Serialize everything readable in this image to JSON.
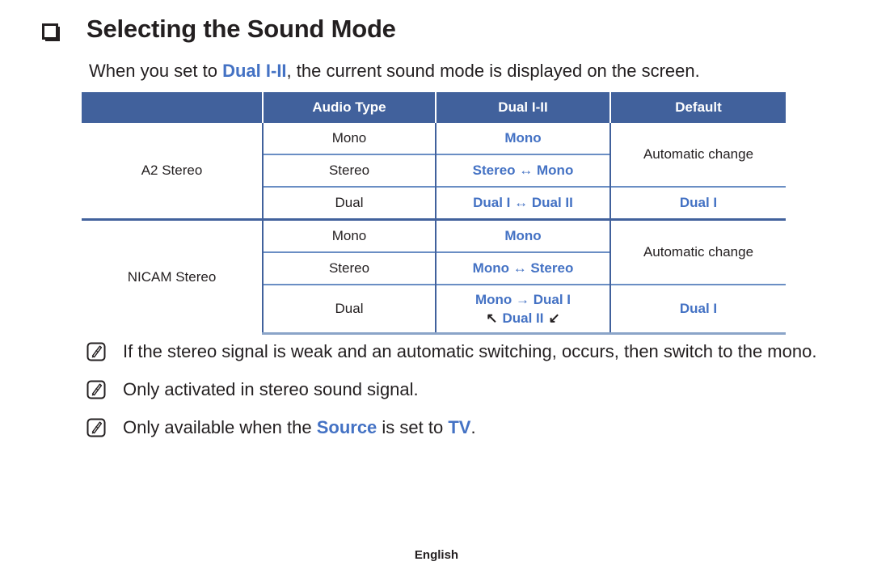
{
  "page": {
    "title": "Selecting the Sound Mode",
    "bullet_icon": "square-bullet-icon",
    "intro_before": "When you set to ",
    "intro_highlight": "Dual I-II",
    "intro_after": ", the current sound mode is displayed on the screen.",
    "footer": "English"
  },
  "colors": {
    "header_blue": "#41619c",
    "accent_blue": "#4472c4",
    "rule_blue": "#6a8ec4",
    "text_dark": "#231f20"
  },
  "table": {
    "headers": [
      "",
      "Audio Type",
      "Dual I-II",
      "Default"
    ],
    "groups": [
      {
        "name": "A2 Stereo",
        "rows": [
          {
            "audio_type": "Mono",
            "dual": "Mono",
            "default": "Automatic change"
          },
          {
            "audio_type": "Stereo",
            "dual": "Stereo ↔ Mono",
            "default": ""
          },
          {
            "audio_type": "Dual",
            "dual": "Dual I ↔ Dual II",
            "default": "Dual I"
          }
        ]
      },
      {
        "name": "NICAM Stereo",
        "rows": [
          {
            "audio_type": "Mono",
            "dual": "Mono",
            "default": "Automatic change"
          },
          {
            "audio_type": "Stereo",
            "dual": "Mono ↔ Stereo",
            "default": ""
          },
          {
            "audio_type": "Dual",
            "dual_line1": "Mono → Dual I",
            "dual_line2_arrow_left": "↖",
            "dual_line2_text": "Dual II",
            "dual_line2_arrow_right": "↙",
            "default": "Dual I"
          }
        ]
      }
    ]
  },
  "notes": [
    {
      "icon": "note-pencil-icon",
      "text_before": "If the stereo signal is weak and an automatic switching, occurs, then switch to the mono.",
      "highlight": "",
      "text_after": ""
    },
    {
      "icon": "note-pencil-icon",
      "text_before": "Only activated in stereo sound signal.",
      "highlight": "",
      "text_after": ""
    },
    {
      "icon": "note-pencil-icon",
      "text_before": "Only available when the ",
      "highlight": "Source",
      "text_middle": " is set to ",
      "highlight2": "TV",
      "text_after": "."
    }
  ]
}
